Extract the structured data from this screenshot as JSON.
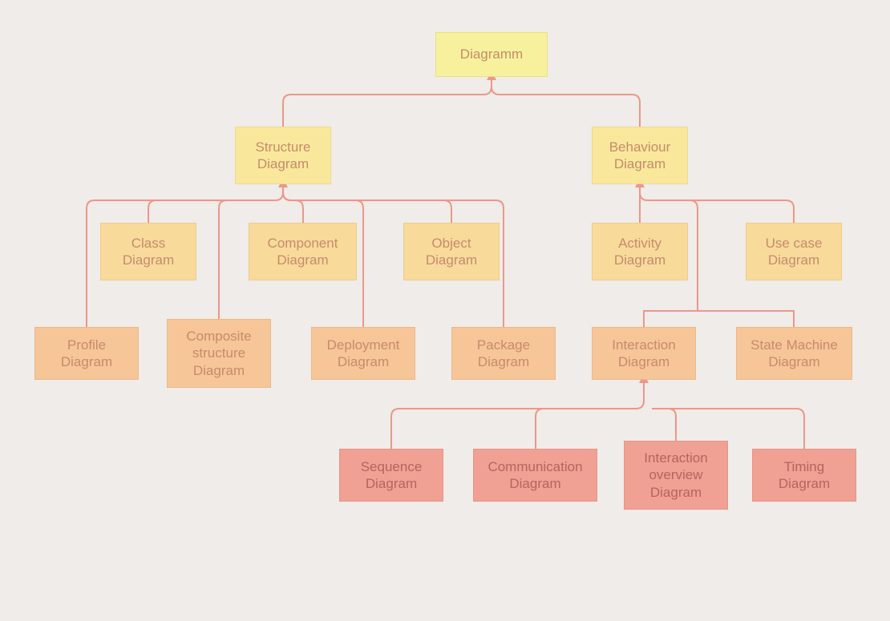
{
  "colors": {
    "background": "#efece9",
    "connector": "#ef9688",
    "level0_fill": "#f7f19e",
    "level1_fill": "#f9e89c",
    "level2_fill": "#f8da9b",
    "level3_fill": "#f6c598",
    "level4_fill": "#f1a094",
    "text": "#c78b6b"
  },
  "nodes": {
    "root": {
      "label": "Diagramm"
    },
    "structure": {
      "label": "Structure\nDiagram"
    },
    "behaviour": {
      "label": "Behaviour\nDiagram"
    },
    "class": {
      "label": "Class\nDiagram"
    },
    "component": {
      "label": "Component\nDiagram"
    },
    "object": {
      "label": "Object\nDiagram"
    },
    "activity": {
      "label": "Activity\nDiagram"
    },
    "usecase": {
      "label": "Use case\nDiagram"
    },
    "profile": {
      "label": "Profile\nDiagram"
    },
    "composite": {
      "label": "Composite\nstructure\nDiagram"
    },
    "deployment": {
      "label": "Deployment\nDiagram"
    },
    "package": {
      "label": "Package\nDiagram"
    },
    "interaction": {
      "label": "Interaction\nDiagram"
    },
    "statemach": {
      "label": "State Machine\nDiagram"
    },
    "sequence": {
      "label": "Sequence\nDiagram"
    },
    "communication": {
      "label": "Communication\nDiagram"
    },
    "iaoverview": {
      "label": "Interaction\noverview\nDiagram"
    },
    "timing": {
      "label": "Timing\nDiagram"
    }
  },
  "hierarchy": {
    "Diagramm": {
      "Structure Diagram": [
        "Class Diagram",
        "Component Diagram",
        "Object Diagram",
        "Profile Diagram",
        "Composite structure Diagram",
        "Deployment Diagram",
        "Package Diagram"
      ],
      "Behaviour Diagram": {
        "Activity Diagram": [],
        "Use case Diagram": [],
        "State Machine Diagram": [],
        "Interaction Diagram": [
          "Sequence Diagram",
          "Communication Diagram",
          "Interaction overview Diagram",
          "Timing Diagram"
        ]
      }
    }
  }
}
